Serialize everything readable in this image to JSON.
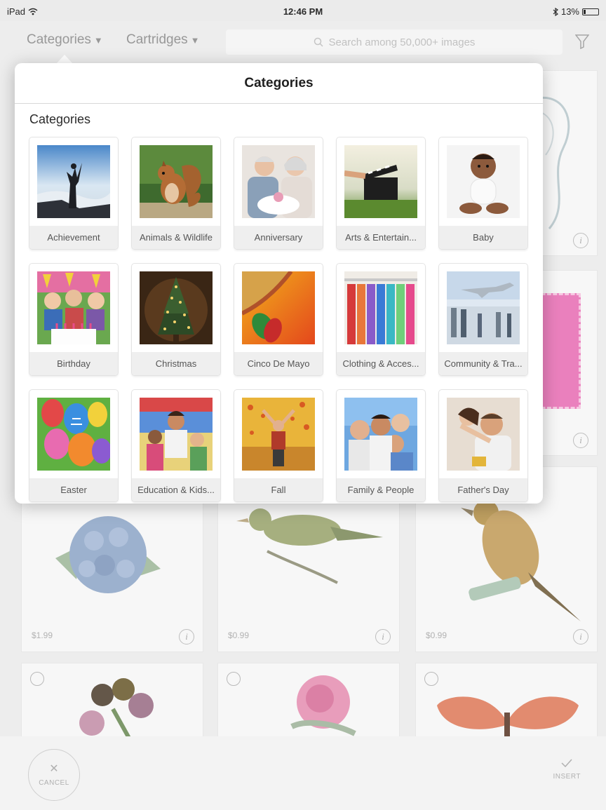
{
  "status_bar": {
    "device": "iPad",
    "time": "12:46 PM",
    "battery": "13%",
    "wifi_icon": "wifi-icon",
    "bluetooth_icon": "bluetooth-icon"
  },
  "nav": {
    "categories_tab": "Categories",
    "cartridges_tab": "Cartridges",
    "search_placeholder": "Search among 50,000+ images"
  },
  "background_grid": {
    "prices": [
      "$1.99",
      "$0.99",
      "$0.99"
    ],
    "info_glyph": "i"
  },
  "bottom_bar": {
    "cancel_label": "CANCEL",
    "insert_label": "INSERT"
  },
  "popover": {
    "title": "Categories",
    "section_label": "Categories",
    "categories": [
      {
        "label": "Achievement"
      },
      {
        "label": "Animals & Wildlife"
      },
      {
        "label": "Anniversary"
      },
      {
        "label": "Arts & Entertain..."
      },
      {
        "label": "Baby"
      },
      {
        "label": "Birthday"
      },
      {
        "label": "Christmas"
      },
      {
        "label": "Cinco De Mayo"
      },
      {
        "label": "Clothing & Acces..."
      },
      {
        "label": "Community & Tra..."
      },
      {
        "label": "Easter"
      },
      {
        "label": "Education & Kids..."
      },
      {
        "label": "Fall"
      },
      {
        "label": "Family & People"
      },
      {
        "label": "Father's Day"
      }
    ]
  },
  "colors": {
    "accent_pink": "#e23a8f",
    "nav_text": "#8a8a8a",
    "label_bg": "#efefef"
  }
}
